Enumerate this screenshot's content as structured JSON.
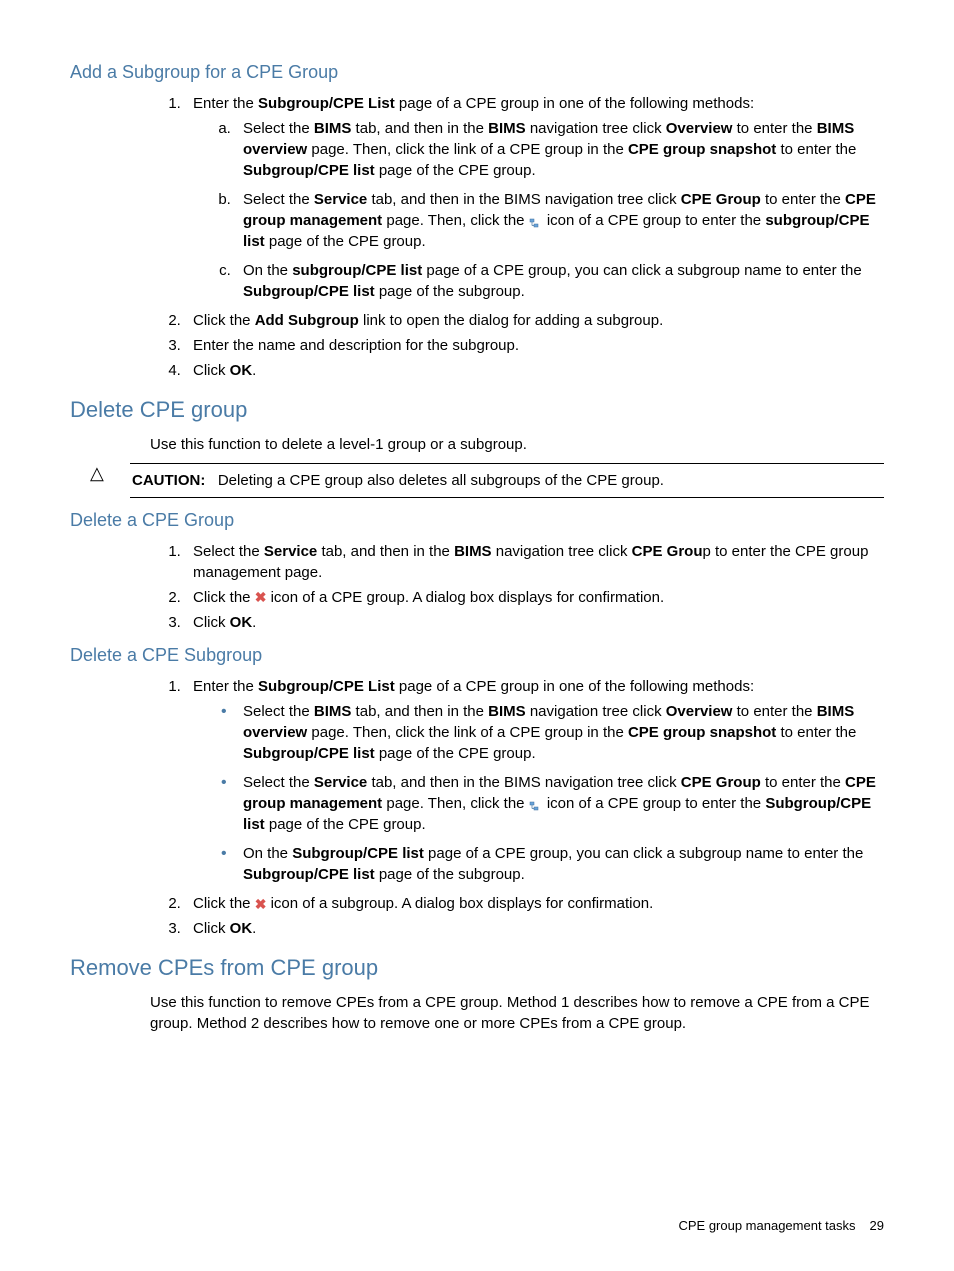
{
  "sections": {
    "addSubgroup": {
      "title": "Add a Subgroup for a CPE Group",
      "step1_intro": "Enter the ",
      "step1_b1": "Subgroup/CPE List",
      "step1_rest": " page of a CPE group in one of the following methods:",
      "a": {
        "t1": "Select the ",
        "b1": "BIMS",
        "t2": " tab, and then in the ",
        "b2": "BIMS",
        "t3": " navigation tree click ",
        "b3": "Overview",
        "t4": " to enter the ",
        "b4": "BIMS overview",
        "t5": " page. Then, click the link of a CPE group in the ",
        "b5": "CPE group snapshot",
        "t6": " to enter the ",
        "b6": "Subgroup/CPE list",
        "t7": " page of the CPE group."
      },
      "b": {
        "t1": "Select the ",
        "b1": "Service",
        "t2": " tab, and then in the BIMS navigation tree click ",
        "b2": "CPE Group",
        "t3": " to enter the ",
        "b3": "CPE group management",
        "t4": " page. Then, click the ",
        "t5": " icon of a CPE group to enter the ",
        "b4": "subgroup/CPE list",
        "t6": " page of the CPE group."
      },
      "c": {
        "t1": "On the ",
        "b1": "subgroup/CPE list",
        "t2": " page of a CPE group, you can click a subgroup name to enter the ",
        "b2": "Subgroup/CPE list",
        "t3": " page of the subgroup."
      },
      "step2": {
        "t1": "Click the ",
        "b1": "Add Subgroup",
        "t2": " link to open the dialog for adding a subgroup."
      },
      "step3": "Enter the name and description for the subgroup.",
      "step4": {
        "t1": "Click ",
        "b1": "OK",
        "t2": "."
      }
    },
    "deleteGroup": {
      "title": "Delete CPE group",
      "intro": "Use this function to delete a level-1 group or a subgroup.",
      "caution_label": "CAUTION:",
      "caution_text": "Deleting a CPE group also deletes all subgroups of the CPE group."
    },
    "deleteCpeGroup": {
      "title": "Delete a CPE Group",
      "step1": {
        "t1": "Select the ",
        "b1": "Service",
        "t2": " tab, and then in the ",
        "b2": "BIMS",
        "t3": " navigation tree click ",
        "b3": "CPE Grou",
        "t4": "p to enter the CPE group management page."
      },
      "step2": {
        "t1": "Click the ",
        "t2": " icon of a CPE group. A dialog box displays for confirmation."
      },
      "step3": {
        "t1": "Click ",
        "b1": "OK",
        "t2": "."
      }
    },
    "deleteSubgroup": {
      "title": "Delete a CPE Subgroup",
      "step1_intro": "Enter the ",
      "step1_b1": "Subgroup/CPE List",
      "step1_rest": " page of a CPE group in one of the following methods:",
      "a": {
        "t1": "Select the ",
        "b1": "BIMS",
        "t2": " tab, and then in the ",
        "b2": "BIMS",
        "t3": " navigation tree click ",
        "b3": "Overview",
        "t4": " to enter the ",
        "b4": "BIMS overview",
        "t5": " page. Then, click the link of a CPE group in the ",
        "b5": "CPE group snapshot",
        "t6": " to enter the ",
        "b6": "Subgroup/CPE list",
        "t7": " page of the CPE group."
      },
      "b": {
        "t1": "Select the ",
        "b1": "Service",
        "t2": " tab, and then in the BIMS navigation tree click ",
        "b2": "CPE Group",
        "t3": " to enter the ",
        "b3": "CPE group management",
        "t4": " page. Then, click the ",
        "t5": " icon of a CPE group to enter the ",
        "b4": "Subgroup/CPE list",
        "t6": " page of the CPE group."
      },
      "c": {
        "t1": "On the ",
        "b1": "Subgroup/CPE list",
        "t2": " page of a CPE group, you can click a subgroup name to enter the ",
        "b2": "Subgroup/CPE list",
        "t3": " page of the subgroup."
      },
      "step2": {
        "t1": "Click the ",
        "t2": " icon of a subgroup. A dialog box displays for confirmation."
      },
      "step3": {
        "t1": "Click ",
        "b1": "OK",
        "t2": "."
      }
    },
    "removeCpes": {
      "title": "Remove CPEs from CPE group",
      "intro": "Use this function to remove CPEs from a CPE group. Method 1 describes how to remove a CPE from a CPE group. Method 2 describes how to remove one or more CPEs from a CPE group."
    }
  },
  "footer": {
    "text": "CPE group management tasks",
    "page": "29"
  },
  "icons": {
    "caution": "△",
    "x": "✖"
  }
}
